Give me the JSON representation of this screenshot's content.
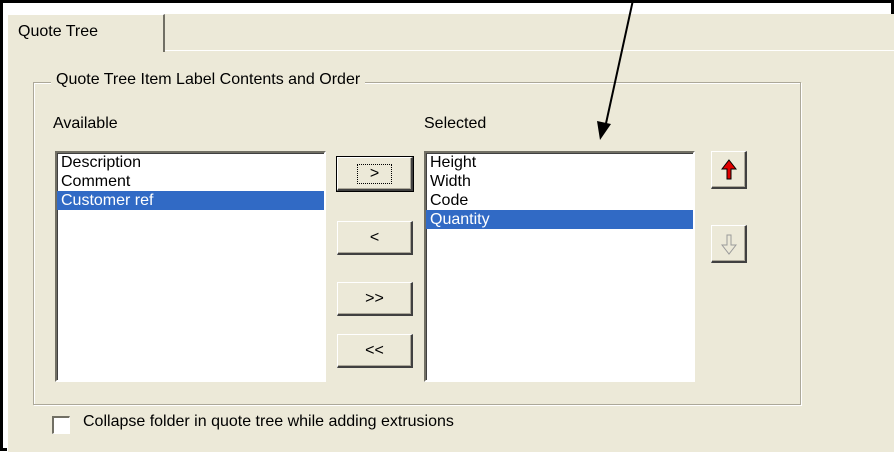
{
  "tab": {
    "label": "Quote Tree"
  },
  "group": {
    "title": "Quote Tree Item Label Contents and Order"
  },
  "available": {
    "label": "Available",
    "items": [
      {
        "text": "Description",
        "selected": false
      },
      {
        "text": "Comment",
        "selected": false
      },
      {
        "text": "Customer ref",
        "selected": true
      }
    ]
  },
  "selected": {
    "label": "Selected",
    "items": [
      {
        "text": "Height",
        "selected": false
      },
      {
        "text": "Width",
        "selected": false
      },
      {
        "text": "Code",
        "selected": false
      },
      {
        "text": "Quantity",
        "selected": true
      }
    ]
  },
  "buttons": {
    "add": ">",
    "remove": "<",
    "add_all": ">>",
    "remove_all": "<<"
  },
  "order_buttons": {
    "up_icon": "red-up-arrow-icon",
    "down_icon": "hollow-down-arrow-icon",
    "up_color": "#e00000"
  },
  "option": {
    "label": "Collapse folder in quote tree while adding extrusions",
    "checked": false
  },
  "colors": {
    "panel": "#ece9d8",
    "selection": "#316ac5"
  }
}
